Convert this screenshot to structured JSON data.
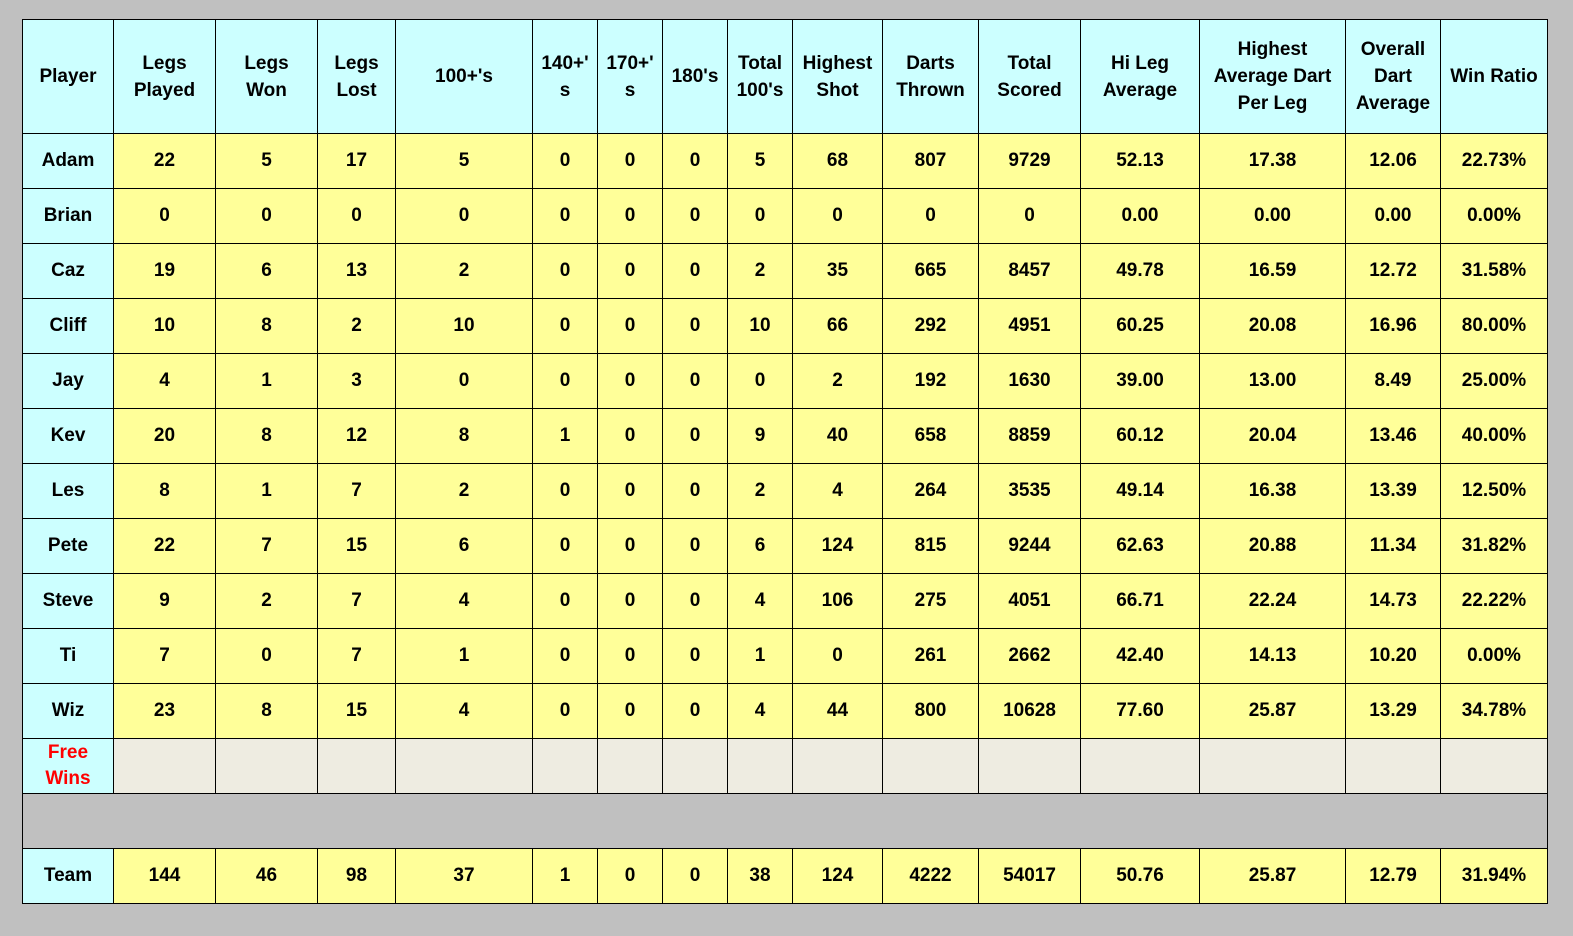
{
  "headers": [
    "Player",
    "Legs Played",
    "Legs Won",
    "Legs Lost",
    "100+'s",
    "140+' s",
    "170+' s",
    "180's",
    "Total 100's",
    "Highest Shot",
    "Darts Thrown",
    "Total Scored",
    "Hi Leg Average",
    "Highest Average Dart Per Leg",
    "Overall Dart Average",
    "Win Ratio"
  ],
  "rows": [
    [
      "Adam",
      "22",
      "5",
      "17",
      "5",
      "0",
      "0",
      "0",
      "5",
      "68",
      "807",
      "9729",
      "52.13",
      "17.38",
      "12.06",
      "22.73%"
    ],
    [
      "Brian",
      "0",
      "0",
      "0",
      "0",
      "0",
      "0",
      "0",
      "0",
      "0",
      "0",
      "0",
      "0.00",
      "0.00",
      "0.00",
      "0.00%"
    ],
    [
      "Caz",
      "19",
      "6",
      "13",
      "2",
      "0",
      "0",
      "0",
      "2",
      "35",
      "665",
      "8457",
      "49.78",
      "16.59",
      "12.72",
      "31.58%"
    ],
    [
      "Cliff",
      "10",
      "8",
      "2",
      "10",
      "0",
      "0",
      "0",
      "10",
      "66",
      "292",
      "4951",
      "60.25",
      "20.08",
      "16.96",
      "80.00%"
    ],
    [
      "Jay",
      "4",
      "1",
      "3",
      "0",
      "0",
      "0",
      "0",
      "0",
      "2",
      "192",
      "1630",
      "39.00",
      "13.00",
      "8.49",
      "25.00%"
    ],
    [
      "Kev",
      "20",
      "8",
      "12",
      "8",
      "1",
      "0",
      "0",
      "9",
      "40",
      "658",
      "8859",
      "60.12",
      "20.04",
      "13.46",
      "40.00%"
    ],
    [
      "Les",
      "8",
      "1",
      "7",
      "2",
      "0",
      "0",
      "0",
      "2",
      "4",
      "264",
      "3535",
      "49.14",
      "16.38",
      "13.39",
      "12.50%"
    ],
    [
      "Pete",
      "22",
      "7",
      "15",
      "6",
      "0",
      "0",
      "0",
      "6",
      "124",
      "815",
      "9244",
      "62.63",
      "20.88",
      "11.34",
      "31.82%"
    ],
    [
      "Steve",
      "9",
      "2",
      "7",
      "4",
      "0",
      "0",
      "0",
      "4",
      "106",
      "275",
      "4051",
      "66.71",
      "22.24",
      "14.73",
      "22.22%"
    ],
    [
      "Ti",
      "7",
      "0",
      "7",
      "1",
      "0",
      "0",
      "0",
      "1",
      "0",
      "261",
      "2662",
      "42.40",
      "14.13",
      "10.20",
      "0.00%"
    ],
    [
      "Wiz",
      "23",
      "8",
      "15",
      "4",
      "0",
      "0",
      "0",
      "4",
      "44",
      "800",
      "10628",
      "77.60",
      "25.87",
      "13.29",
      "34.78%"
    ]
  ],
  "free_wins_label": "Free Wins",
  "team_row": [
    "Team",
    "144",
    "46",
    "98",
    "37",
    "1",
    "0",
    "0",
    "38",
    "124",
    "4222",
    "54017",
    "50.76",
    "25.87",
    "12.79",
    "31.94%"
  ],
  "colors": {
    "header_bg": "#ccffff",
    "value_bg": "#ffff99",
    "empty_bg": "#eeece1",
    "page_bg": "#c0c0c0",
    "free_wins_text": "#ff0000"
  }
}
